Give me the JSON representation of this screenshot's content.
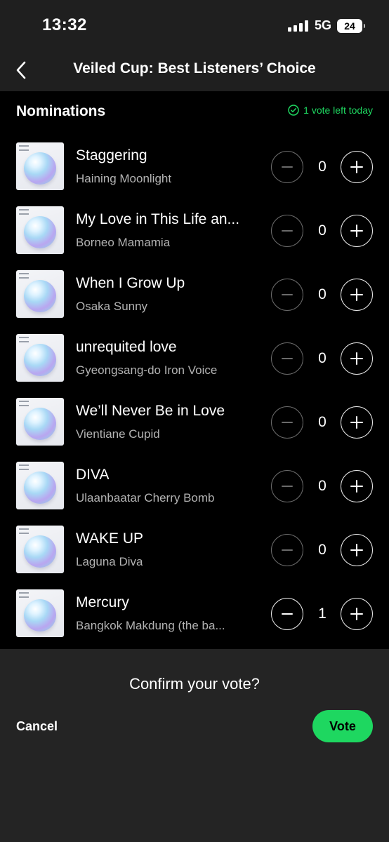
{
  "status": {
    "time": "13:32",
    "network": "5G",
    "battery": "24"
  },
  "header": {
    "title": "Veiled Cup: Best Listeners’ Choice"
  },
  "nominations": {
    "title": "Nominations",
    "votes_left": "1 vote left today",
    "accent": "#1ed760",
    "items": [
      {
        "song": "Staggering",
        "artist": "Haining Moonlight",
        "count": "0"
      },
      {
        "song": "My Love in This Life an...",
        "artist": "Borneo Mamamia",
        "count": "0"
      },
      {
        "song": "When I Grow Up",
        "artist": "Osaka Sunny",
        "count": "0"
      },
      {
        "song": "unrequited love",
        "artist": "Gyeongsang-do Iron Voice",
        "count": "0"
      },
      {
        "song": "We’ll Never Be in Love",
        "artist": "Vientiane Cupid",
        "count": "0"
      },
      {
        "song": "DIVA",
        "artist": "Ulaanbaatar Cherry Bomb",
        "count": "0"
      },
      {
        "song": "WAKE UP",
        "artist": "Laguna Diva",
        "count": "0"
      },
      {
        "song": "Mercury",
        "artist": "Bangkok Makdung (the ba...",
        "count": "1"
      }
    ]
  },
  "sheet": {
    "prompt": "Confirm your vote?",
    "cancel_label": "Cancel",
    "vote_label": "Vote"
  }
}
